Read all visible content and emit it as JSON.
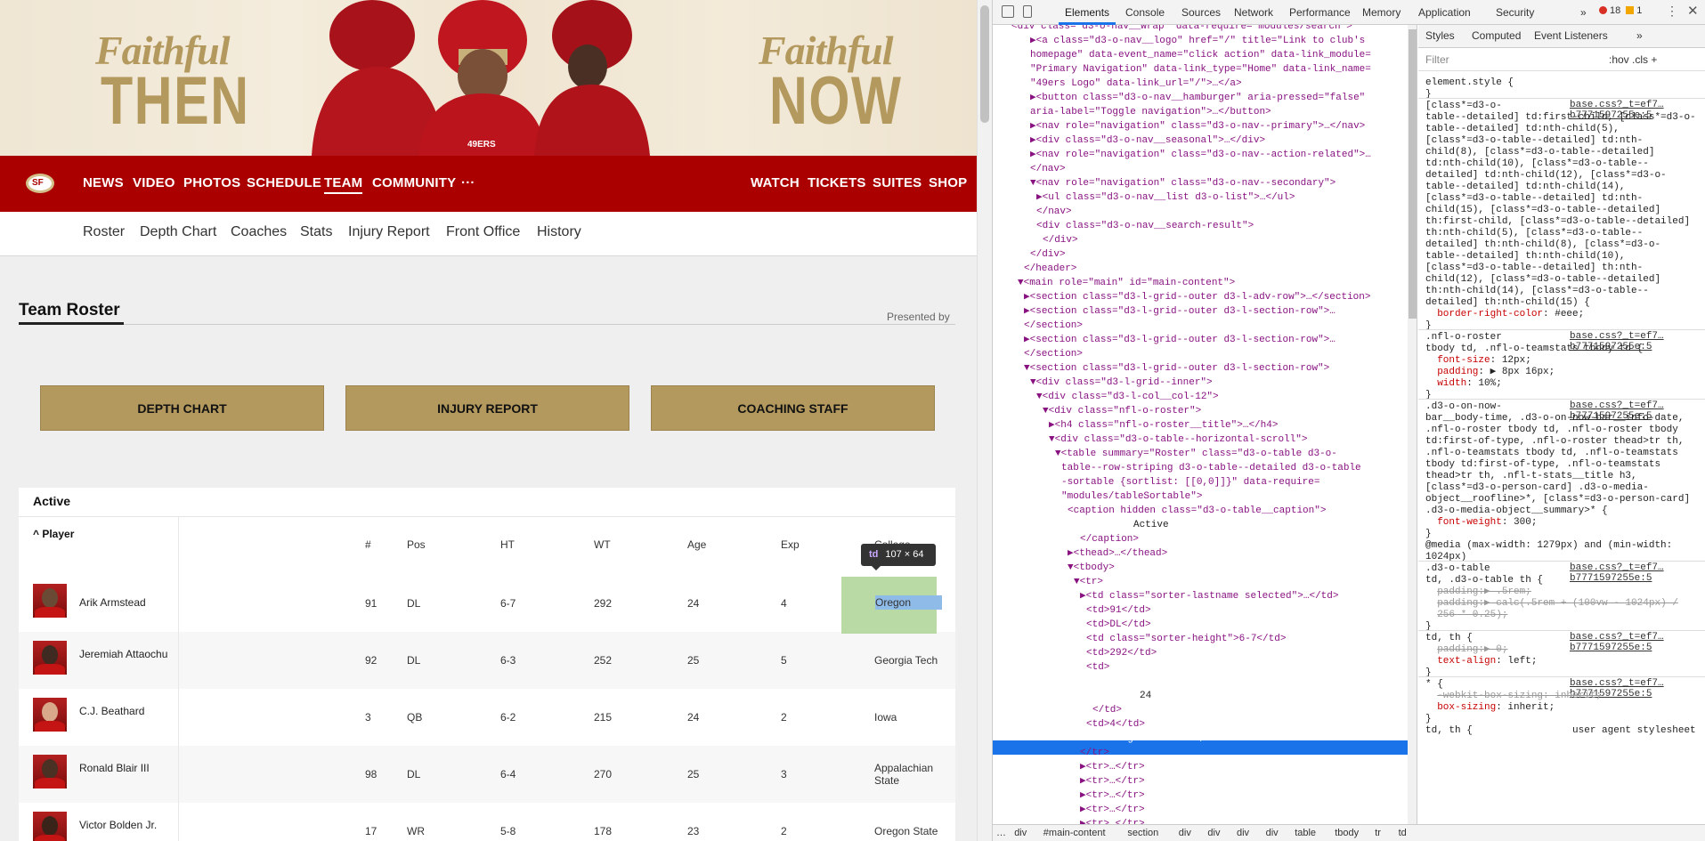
{
  "hero": {
    "left_script": "Faithful",
    "left_word": "THEN",
    "right_script": "Faithful",
    "right_word": "NOW"
  },
  "nav": {
    "logo_text": "SF",
    "items": [
      "NEWS",
      "VIDEO",
      "PHOTOS",
      "SCHEDULE",
      "TEAM",
      "COMMUNITY",
      "···"
    ],
    "right_items": [
      "WATCH",
      "TICKETS",
      "SUITES",
      "SHOP"
    ],
    "active": "TEAM"
  },
  "subnav": [
    "Roster",
    "Depth Chart",
    "Coaches",
    "Stats",
    "Injury Report",
    "Front Office",
    "History"
  ],
  "page": {
    "title": "Team Roster",
    "presented_by": "Presented by",
    "buttons": [
      "DEPTH CHART",
      "INJURY REPORT",
      "COACHING STAFF"
    ]
  },
  "table": {
    "caption": "Active",
    "player_header": "^ Player",
    "headers": [
      "#",
      "Pos",
      "HT",
      "WT",
      "Age",
      "Exp",
      "College"
    ],
    "rows": [
      {
        "name": "Arik Armstead",
        "num": "91",
        "pos": "DL",
        "ht": "6-7",
        "wt": "292",
        "age": "24",
        "exp": "4",
        "college": "Oregon"
      },
      {
        "name": "Jeremiah Attaochu",
        "num": "92",
        "pos": "DL",
        "ht": "6-3",
        "wt": "252",
        "age": "25",
        "exp": "5",
        "college": "Georgia Tech"
      },
      {
        "name": "C.J. Beathard",
        "num": "3",
        "pos": "QB",
        "ht": "6-2",
        "wt": "215",
        "age": "24",
        "exp": "2",
        "college": "Iowa"
      },
      {
        "name": "Ronald Blair III",
        "num": "98",
        "pos": "DL",
        "ht": "6-4",
        "wt": "270",
        "age": "25",
        "exp": "3",
        "college": "Appalachian State"
      },
      {
        "name": "Victor Bolden Jr.",
        "num": "17",
        "pos": "WR",
        "ht": "5-8",
        "wt": "178",
        "age": "23",
        "exp": "2",
        "college": "Oregon State"
      }
    ]
  },
  "tooltip": {
    "tag": "td",
    "size": "107 × 64"
  },
  "devtools": {
    "tabs": [
      "Elements",
      "Console",
      "Sources",
      "Network",
      "Performance",
      "Memory",
      "Application",
      "Security",
      "»"
    ],
    "errors": "18",
    "warnings": "1",
    "elements_lines": [
      "<div class=\"d3-o-nav__wrap\" data-require=\"modules/search\">",
      "▶<a class=\"d3-o-nav__logo\" href=\"/\" title=\"Link to club's",
      "homepage\" data-event_name=\"click action\" data-link_module=",
      "\"Primary Navigation\" data-link_type=\"Home\" data-link_name=",
      "\"49ers Logo\" data-link_url=\"/\">…</a>",
      "▶<button class=\"d3-o-nav__hamburger\" aria-pressed=\"false\"",
      "aria-label=\"Toggle navigation\">…</button>",
      "▶<nav role=\"navigation\" class=\"d3-o-nav--primary\">…</nav>",
      "▶<div class=\"d3-o-nav__seasonal\">…</div>",
      "▶<nav role=\"navigation\" class=\"d3-o-nav--action-related\">…",
      "</nav>",
      "▼<nav role=\"navigation\" class=\"d3-o-nav--secondary\">",
      "▶<ul class=\"d3-o-nav__list d3-o-list\">…</ul>",
      "</nav>",
      "<div class=\"d3-o-nav__search-result\">",
      "</div>",
      "</div>",
      "</header>",
      "▼<main role=\"main\" id=\"main-content\">",
      "▶<section class=\"d3-l-grid--outer d3-l-adv-row\">…</section>",
      "▶<section class=\"d3-l-grid--outer d3-l-section-row\">…",
      "</section>",
      "▶<section class=\"d3-l-grid--outer d3-l-section-row\">…",
      "</section>",
      "▼<section class=\"d3-l-grid--outer d3-l-section-row\">",
      "▼<div class=\"d3-l-grid--inner\">",
      "▼<div class=\"d3-l-col__col-12\">",
      "▼<div class=\"nfl-o-roster\">",
      "▶<h4 class=\"nfl-o-roster__title\">…</h4>",
      "▼<div class=\"d3-o-table--horizontal-scroll\">",
      "▼<table summary=\"Roster\" class=\"d3-o-table d3-o-",
      "table--row-striping d3-o-table--detailed d3-o-table",
      "-sortable {sortlist: [[0,0]]}\" data-require=",
      "\"modules/tableSortable\">",
      "<caption hidden class=\"d3-o-table__caption\">",
      "Active",
      "</caption>",
      "▶<thead>…</thead>",
      "▼<tbody>",
      "▼<tr>",
      "▶<td class=\"sorter-lastname selected\">…</td>",
      "<td>91</td>",
      "<td>DL</td>",
      "<td class=\"sorter-height\">6-7</td>",
      "<td>292</td>",
      "<td>",
      "",
      "24",
      "</td>",
      "<td>4</td>",
      "<td>Oregon</td> == $0",
      "</tr>",
      "▶<tr>…</tr>",
      "▶<tr>…</tr>",
      "▶<tr>…</tr>",
      "▶<tr>…</tr>",
      "▶<tr>…</tr>",
      "▶<tr>…</tr>"
    ],
    "breadcrumb": [
      "…",
      "div",
      "#main-content",
      "section",
      "div",
      "div",
      "div",
      "div",
      "table",
      "tbody",
      "tr",
      "td"
    ],
    "style_tabs": [
      "Styles",
      "Computed",
      "Event Listeners",
      "»"
    ],
    "filter_placeholder": "Filter",
    "hov": ":hov  .cls  +",
    "styles": [
      {
        "type": "text",
        "text": "element.style {"
      },
      {
        "type": "text",
        "text": "}"
      },
      {
        "type": "src",
        "text": "base.css?_t=ef7…b7771597255e:5"
      },
      {
        "type": "sel",
        "text": "[class*=d3-o-"
      },
      {
        "type": "sel",
        "text": "table--detailed] td:first-child, [class*=d3-o-"
      },
      {
        "type": "sel",
        "text": "table--detailed] td:nth-child(5),"
      },
      {
        "type": "sel",
        "text": "[class*=d3-o-table--detailed] td:nth-"
      },
      {
        "type": "sel",
        "text": "child(8), [class*=d3-o-table--detailed]"
      },
      {
        "type": "sel",
        "text": "td:nth-child(10), [class*=d3-o-table--"
      },
      {
        "type": "sel",
        "text": "detailed] td:nth-child(12), [class*=d3-o-"
      },
      {
        "type": "sel",
        "text": "table--detailed] td:nth-child(14),"
      },
      {
        "type": "sel",
        "text": "[class*=d3-o-table--detailed] td:nth-"
      },
      {
        "type": "sel",
        "text": "child(15), [class*=d3-o-table--detailed]"
      },
      {
        "type": "sel",
        "text": "th:first-child, [class*=d3-o-table--detailed]"
      },
      {
        "type": "sel",
        "text": "th:nth-child(5), [class*=d3-o-table--"
      },
      {
        "type": "sel",
        "text": "detailed] th:nth-child(8), [class*=d3-o-"
      },
      {
        "type": "sel",
        "text": "table--detailed] th:nth-child(10),"
      },
      {
        "type": "sel",
        "text": "[class*=d3-o-table--detailed] th:nth-"
      },
      {
        "type": "sel",
        "text": "child(12), [class*=d3-o-table--detailed]"
      },
      {
        "type": "sel",
        "text": "th:nth-child(14), [class*=d3-o-table--"
      },
      {
        "type": "sel",
        "text": "detailed] th:nth-child(15) {"
      },
      {
        "type": "prop",
        "name": "border-right-color",
        "value": "#eee;"
      },
      {
        "type": "text",
        "text": "}"
      },
      {
        "type": "src",
        "text": "base.css?_t=ef7…b7771597255e:5"
      },
      {
        "type": "sel",
        "text": ".nfl-o-roster"
      },
      {
        "type": "sel",
        "text": "tbody td, .nfl-o-teamstats tbody td {"
      },
      {
        "type": "prop",
        "name": "font-size",
        "value": "12px;"
      },
      {
        "type": "prop",
        "name": "padding",
        "value": "▶ 8px 16px;"
      },
      {
        "type": "prop",
        "name": "width",
        "value": "10%;"
      },
      {
        "type": "text",
        "text": "}"
      },
      {
        "type": "src",
        "text": "base.css?_t=ef7…b7771597255e:5"
      },
      {
        "type": "sel",
        "text": ".d3-o-on-now-"
      },
      {
        "type": "sel",
        "text": "bar__body-time, .d3-o-on-now-bar__info-date,"
      },
      {
        "type": "sel",
        "text": ".nfl-o-roster tbody td, .nfl-o-roster tbody"
      },
      {
        "type": "sel",
        "text": "td:first-of-type, .nfl-o-roster thead>tr th,"
      },
      {
        "type": "sel",
        "text": ".nfl-o-teamstats tbody td, .nfl-o-teamstats"
      },
      {
        "type": "sel",
        "text": "tbody td:first-of-type, .nfl-o-teamstats"
      },
      {
        "type": "sel",
        "text": "thead>tr th, .nfl-t-stats__title h3,"
      },
      {
        "type": "sel",
        "text": "[class*=d3-o-person-card] .d3-o-media-"
      },
      {
        "type": "sel",
        "text": "object__roofline>*, [class*=d3-o-person-card]"
      },
      {
        "type": "sel",
        "text": ".d3-o-media-object__summary>* {"
      },
      {
        "type": "prop",
        "name": "font-weight",
        "value": "300;"
      },
      {
        "type": "text",
        "text": "}"
      },
      {
        "type": "sel",
        "text": "@media (max-width: 1279px) and (min-width:"
      },
      {
        "type": "sel",
        "text": "1024px)"
      },
      {
        "type": "src",
        "text": "base.css?_t=ef7…b7771597255e:5"
      },
      {
        "type": "sel",
        "text": ".d3-o-table"
      },
      {
        "type": "sel",
        "text": "td, .d3-o-table th {"
      },
      {
        "type": "strike",
        "text": "padding:▶ .5rem;"
      },
      {
        "type": "strike",
        "text": "padding:▶ calc(.5rem + (100vw - 1024px) /"
      },
      {
        "type": "strike",
        "text": "256 * 0.25);"
      },
      {
        "type": "text",
        "text": "}"
      },
      {
        "type": "src",
        "text": "base.css?_t=ef7…b7771597255e:5"
      },
      {
        "type": "sel",
        "text": "td, th {"
      },
      {
        "type": "strike",
        "text": "padding:▶ 0;"
      },
      {
        "type": "prop",
        "name": "text-align",
        "value": "left;"
      },
      {
        "type": "text",
        "text": "}"
      },
      {
        "type": "src",
        "text": "base.css?_t=ef7…b7771597255e:5"
      },
      {
        "type": "sel",
        "text": "* {"
      },
      {
        "type": "strike",
        "text": "-webkit-box-sizing: inherit;"
      },
      {
        "type": "prop",
        "name": "box-sizing",
        "value": "inherit;"
      },
      {
        "type": "text",
        "text": "}"
      },
      {
        "type": "sel",
        "text": "td, th {                 user agent stylesheet"
      }
    ]
  }
}
